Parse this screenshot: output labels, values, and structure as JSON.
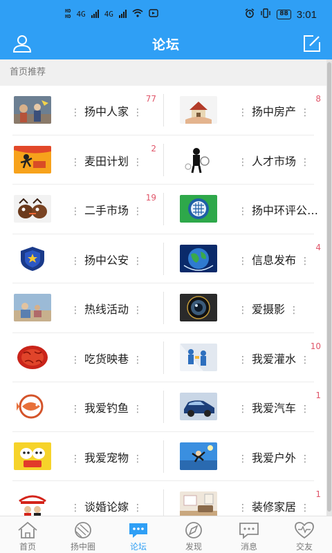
{
  "status": {
    "left": [
      "HD",
      "4G",
      "4G"
    ],
    "battery": "88",
    "time": "3:01"
  },
  "header": {
    "title": "论坛"
  },
  "section": {
    "label": "首页推荐"
  },
  "forums": [
    {
      "name": "扬中人家",
      "count": "77",
      "thumb": "party"
    },
    {
      "name": "扬中房产",
      "count": "8",
      "thumb": "house"
    },
    {
      "name": "麦田计划",
      "count": "2",
      "thumb": "flag"
    },
    {
      "name": "人才市场",
      "count": "",
      "thumb": "people"
    },
    {
      "name": "二手市场",
      "count": "19",
      "thumb": "birds"
    },
    {
      "name": "扬中环评公…",
      "count": "",
      "thumb": "emblem"
    },
    {
      "name": "扬中公安",
      "count": "",
      "thumb": "police"
    },
    {
      "name": "信息发布",
      "count": "4",
      "thumb": "globe"
    },
    {
      "name": "热线活动",
      "count": "",
      "thumb": "photo"
    },
    {
      "name": "爱摄影",
      "count": "",
      "thumb": "camera"
    },
    {
      "name": "吃货映巷",
      "count": "",
      "thumb": "food"
    },
    {
      "name": "我爱灌水",
      "count": "10",
      "thumb": "figures"
    },
    {
      "name": "我爱钓鱼",
      "count": "",
      "thumb": "fish"
    },
    {
      "name": "我爱汽车",
      "count": "1",
      "thumb": "car"
    },
    {
      "name": "我爱宠物",
      "count": "",
      "thumb": "pets"
    },
    {
      "name": "我爱户外",
      "count": "",
      "thumb": "outdoor"
    },
    {
      "name": "谈婚论嫁",
      "count": "",
      "thumb": "wedding"
    },
    {
      "name": "装修家居",
      "count": "1",
      "thumb": "room"
    }
  ],
  "tabs": [
    {
      "label": "首页",
      "icon": "home-icon"
    },
    {
      "label": "扬中圈",
      "icon": "circle-icon"
    },
    {
      "label": "论坛",
      "icon": "forum-icon"
    },
    {
      "label": "发现",
      "icon": "compass-icon"
    },
    {
      "label": "消息",
      "icon": "message-icon"
    },
    {
      "label": "交友",
      "icon": "heart-icon"
    }
  ],
  "colors": {
    "accent": "#2f9ff5",
    "badge": "#e0566a"
  }
}
